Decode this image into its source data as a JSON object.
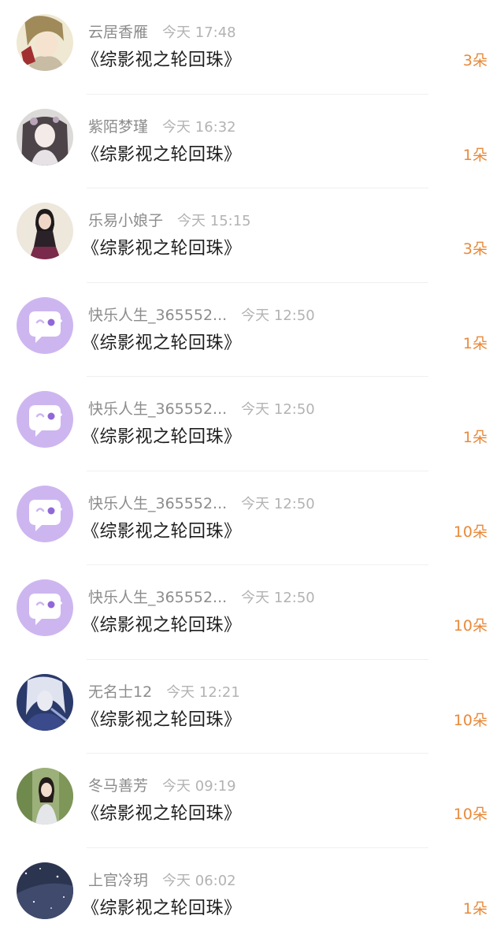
{
  "colors": {
    "name": "#8c8c8c",
    "time": "#b3b3b3",
    "title": "#1e1e1e",
    "count": "#e8893a",
    "default_avatar_bg": "#cdb6f0"
  },
  "gifts": [
    {
      "user": "云居香雁",
      "time": "今天 17:48",
      "book": "《综影视之轮回珠》",
      "count": "3朵",
      "avatar": "anime-boy-avatar"
    },
    {
      "user": "紫陌梦瑾",
      "time": "今天 16:32",
      "book": "《综影视之轮回珠》",
      "count": "1朵",
      "avatar": "anime-girl-avatar"
    },
    {
      "user": "乐易小娘子",
      "time": "今天 15:15",
      "book": "《综影视之轮回珠》",
      "count": "3朵",
      "avatar": "girl-photo-avatar"
    },
    {
      "user": "快乐人生_365552...",
      "time": "今天 12:50",
      "book": "《综影视之轮回珠》",
      "count": "1朵",
      "avatar": "default-chat-bubble-avatar"
    },
    {
      "user": "快乐人生_365552...",
      "time": "今天 12:50",
      "book": "《综影视之轮回珠》",
      "count": "1朵",
      "avatar": "default-chat-bubble-avatar"
    },
    {
      "user": "快乐人生_365552...",
      "time": "今天 12:50",
      "book": "《综影视之轮回珠》",
      "count": "10朵",
      "avatar": "default-chat-bubble-avatar"
    },
    {
      "user": "快乐人生_365552...",
      "time": "今天 12:50",
      "book": "《综影视之轮回珠》",
      "count": "10朵",
      "avatar": "default-chat-bubble-avatar"
    },
    {
      "user": "无名士12",
      "time": "今天 12:21",
      "book": "《综影视之轮回珠》",
      "count": "10朵",
      "avatar": "white-hair-warrior-avatar"
    },
    {
      "user": "冬马善芳",
      "time": "今天 09:19",
      "book": "《综影视之轮回珠》",
      "count": "10朵",
      "avatar": "girl-in-forest-avatar"
    },
    {
      "user": "上官冷玥",
      "time": "今天 06:02",
      "book": "《综影视之轮回珠》",
      "count": "1朵",
      "avatar": "night-sky-avatar"
    }
  ]
}
